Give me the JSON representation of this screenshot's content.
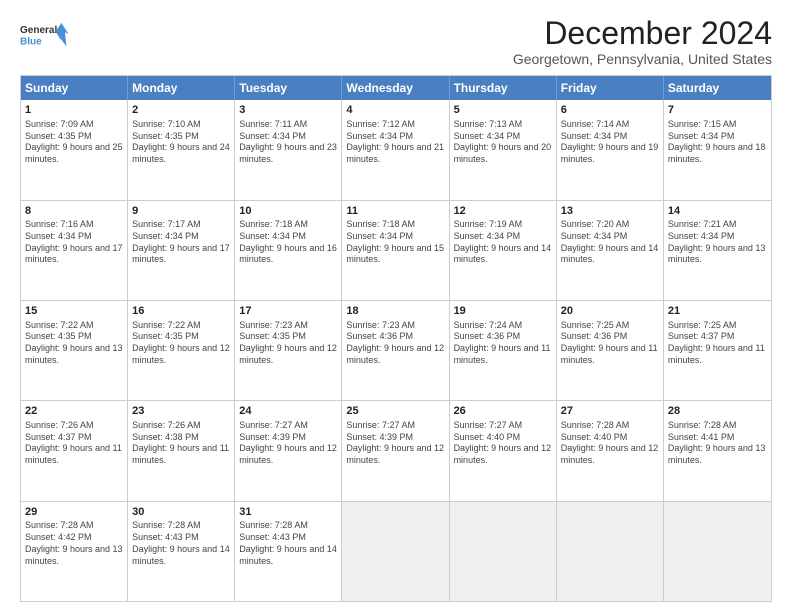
{
  "logo": {
    "line1": "General",
    "line2": "Blue"
  },
  "title": "December 2024",
  "subtitle": "Georgetown, Pennsylvania, United States",
  "days": [
    "Sunday",
    "Monday",
    "Tuesday",
    "Wednesday",
    "Thursday",
    "Friday",
    "Saturday"
  ],
  "weeks": [
    [
      {
        "day": "1",
        "sunrise": "7:09 AM",
        "sunset": "4:35 PM",
        "daylight": "9 hours and 25 minutes."
      },
      {
        "day": "2",
        "sunrise": "7:10 AM",
        "sunset": "4:35 PM",
        "daylight": "9 hours and 24 minutes."
      },
      {
        "day": "3",
        "sunrise": "7:11 AM",
        "sunset": "4:34 PM",
        "daylight": "9 hours and 23 minutes."
      },
      {
        "day": "4",
        "sunrise": "7:12 AM",
        "sunset": "4:34 PM",
        "daylight": "9 hours and 21 minutes."
      },
      {
        "day": "5",
        "sunrise": "7:13 AM",
        "sunset": "4:34 PM",
        "daylight": "9 hours and 20 minutes."
      },
      {
        "day": "6",
        "sunrise": "7:14 AM",
        "sunset": "4:34 PM",
        "daylight": "9 hours and 19 minutes."
      },
      {
        "day": "7",
        "sunrise": "7:15 AM",
        "sunset": "4:34 PM",
        "daylight": "9 hours and 18 minutes."
      }
    ],
    [
      {
        "day": "8",
        "sunrise": "7:16 AM",
        "sunset": "4:34 PM",
        "daylight": "9 hours and 17 minutes."
      },
      {
        "day": "9",
        "sunrise": "7:17 AM",
        "sunset": "4:34 PM",
        "daylight": "9 hours and 17 minutes."
      },
      {
        "day": "10",
        "sunrise": "7:18 AM",
        "sunset": "4:34 PM",
        "daylight": "9 hours and 16 minutes."
      },
      {
        "day": "11",
        "sunrise": "7:18 AM",
        "sunset": "4:34 PM",
        "daylight": "9 hours and 15 minutes."
      },
      {
        "day": "12",
        "sunrise": "7:19 AM",
        "sunset": "4:34 PM",
        "daylight": "9 hours and 14 minutes."
      },
      {
        "day": "13",
        "sunrise": "7:20 AM",
        "sunset": "4:34 PM",
        "daylight": "9 hours and 14 minutes."
      },
      {
        "day": "14",
        "sunrise": "7:21 AM",
        "sunset": "4:34 PM",
        "daylight": "9 hours and 13 minutes."
      }
    ],
    [
      {
        "day": "15",
        "sunrise": "7:22 AM",
        "sunset": "4:35 PM",
        "daylight": "9 hours and 13 minutes."
      },
      {
        "day": "16",
        "sunrise": "7:22 AM",
        "sunset": "4:35 PM",
        "daylight": "9 hours and 12 minutes."
      },
      {
        "day": "17",
        "sunrise": "7:23 AM",
        "sunset": "4:35 PM",
        "daylight": "9 hours and 12 minutes."
      },
      {
        "day": "18",
        "sunrise": "7:23 AM",
        "sunset": "4:36 PM",
        "daylight": "9 hours and 12 minutes."
      },
      {
        "day": "19",
        "sunrise": "7:24 AM",
        "sunset": "4:36 PM",
        "daylight": "9 hours and 11 minutes."
      },
      {
        "day": "20",
        "sunrise": "7:25 AM",
        "sunset": "4:36 PM",
        "daylight": "9 hours and 11 minutes."
      },
      {
        "day": "21",
        "sunrise": "7:25 AM",
        "sunset": "4:37 PM",
        "daylight": "9 hours and 11 minutes."
      }
    ],
    [
      {
        "day": "22",
        "sunrise": "7:26 AM",
        "sunset": "4:37 PM",
        "daylight": "9 hours and 11 minutes."
      },
      {
        "day": "23",
        "sunrise": "7:26 AM",
        "sunset": "4:38 PM",
        "daylight": "9 hours and 11 minutes."
      },
      {
        "day": "24",
        "sunrise": "7:27 AM",
        "sunset": "4:39 PM",
        "daylight": "9 hours and 12 minutes."
      },
      {
        "day": "25",
        "sunrise": "7:27 AM",
        "sunset": "4:39 PM",
        "daylight": "9 hours and 12 minutes."
      },
      {
        "day": "26",
        "sunrise": "7:27 AM",
        "sunset": "4:40 PM",
        "daylight": "9 hours and 12 minutes."
      },
      {
        "day": "27",
        "sunrise": "7:28 AM",
        "sunset": "4:40 PM",
        "daylight": "9 hours and 12 minutes."
      },
      {
        "day": "28",
        "sunrise": "7:28 AM",
        "sunset": "4:41 PM",
        "daylight": "9 hours and 13 minutes."
      }
    ],
    [
      {
        "day": "29",
        "sunrise": "7:28 AM",
        "sunset": "4:42 PM",
        "daylight": "9 hours and 13 minutes."
      },
      {
        "day": "30",
        "sunrise": "7:28 AM",
        "sunset": "4:43 PM",
        "daylight": "9 hours and 14 minutes."
      },
      {
        "day": "31",
        "sunrise": "7:28 AM",
        "sunset": "4:43 PM",
        "daylight": "9 hours and 14 minutes."
      },
      null,
      null,
      null,
      null
    ]
  ]
}
